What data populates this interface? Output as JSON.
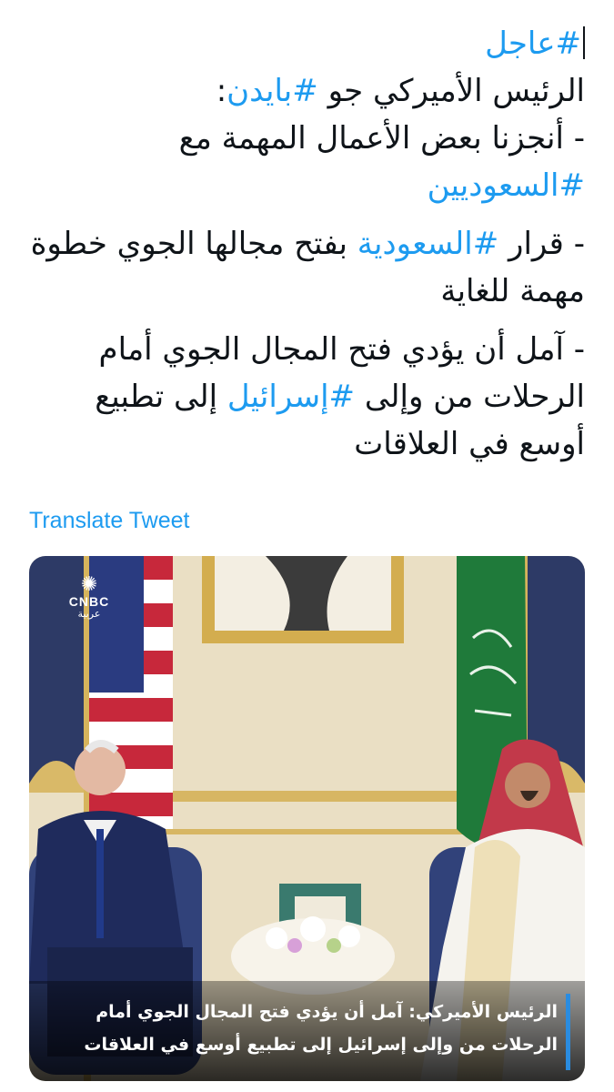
{
  "tweet": {
    "p1": {
      "tag_breaking": "#عاجل",
      "line2_text": "الرئيس الأميركي جو ",
      "tag_biden": "#بايدن",
      "line2_colon": ":",
      "line3_text": "- أنجزنا بعض الأعمال المهمة مع ",
      "tag_saudis": "#السعوديين"
    },
    "p2": {
      "prefix": "- قرار ",
      "tag_saudi": "#السعودية",
      "suffix": " بفتح مجالها الجوي خطوة مهمة للغاية"
    },
    "p3": {
      "prefix": "- آمل أن يؤدي فتح المجال الجوي أمام الرحلات من وإلى ",
      "tag_israel": "#إسرائيل",
      "suffix": " إلى تطبيع أوسع في العلاقات"
    }
  },
  "translate_link": "Translate Tweet",
  "media": {
    "logo_name": "CNBC",
    "logo_sub": "عربية",
    "caption_line1": "الرئيس الأميركي: آمل أن يؤدي فتح المجال الجوي أمام",
    "caption_line2": "الرحلات من وإلى إسرائيل إلى تطبيع أوسع في العلاقات"
  },
  "colors": {
    "link": "#1d9bf0",
    "text": "#0f1419",
    "caption_accent": "#2a8ce0"
  }
}
